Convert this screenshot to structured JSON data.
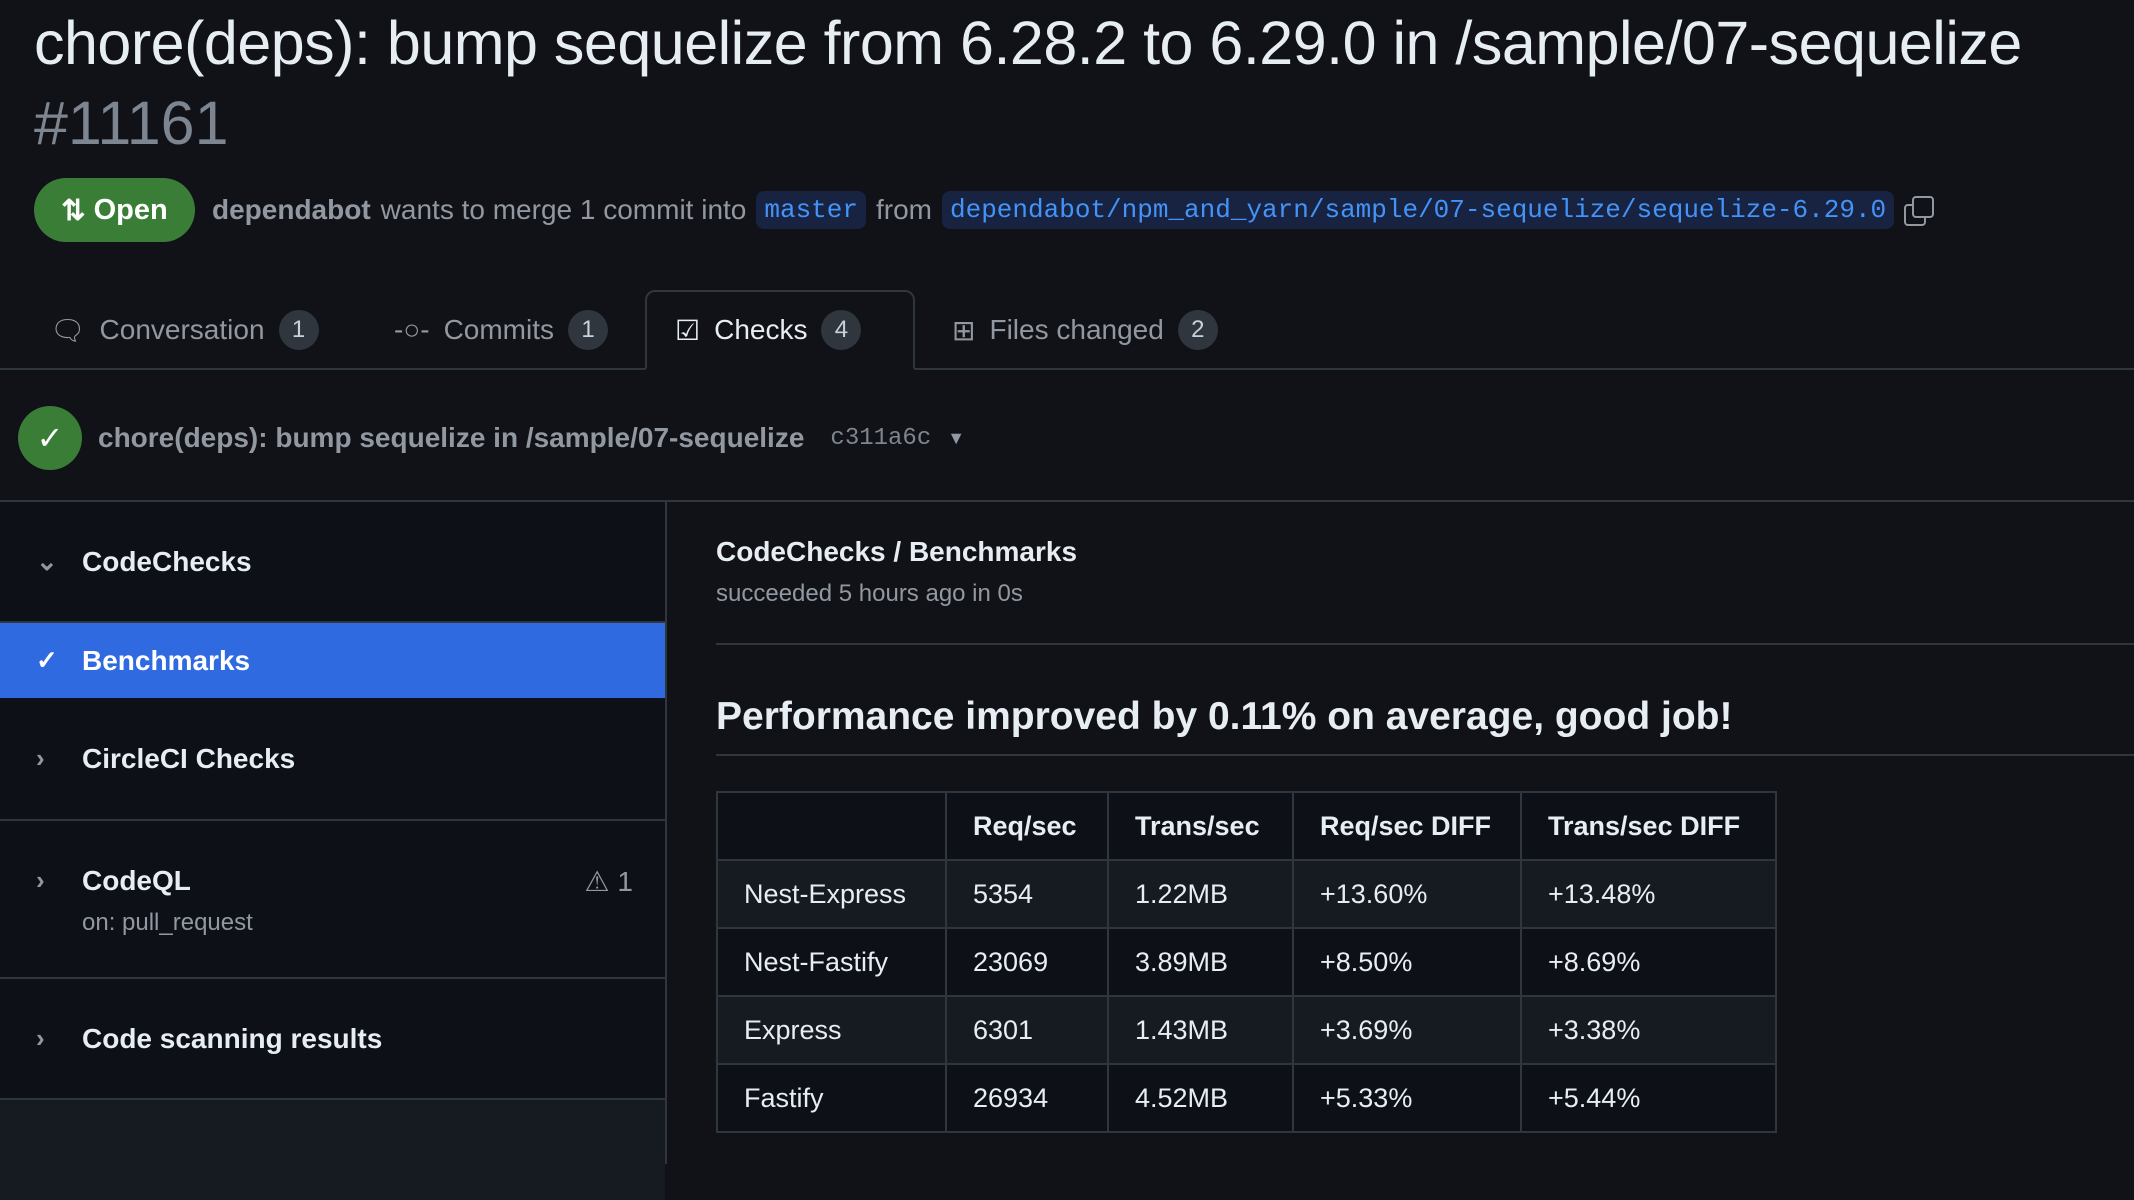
{
  "pr": {
    "title": "chore(deps): bump sequelize from 6.28.2 to 6.29.0 in /sample/07-sequelize",
    "number": "#11161",
    "state": "Open",
    "author": "dependabot",
    "merge_text": "wants to merge 1 commit into",
    "base": "master",
    "from": "from",
    "head": "dependabot/npm_and_yarn/sample/07-sequelize/sequelize-6.29.0"
  },
  "tabs": [
    {
      "label": "Conversation",
      "count": "1"
    },
    {
      "label": "Commits",
      "count": "1"
    },
    {
      "label": "Checks",
      "count": "4"
    },
    {
      "label": "Files changed",
      "count": "2"
    }
  ],
  "commit": {
    "message": "chore(deps): bump sequelize in /sample/07-sequelize",
    "sha": "c311a6c"
  },
  "sidebar": {
    "items": [
      {
        "label": "CodeChecks"
      },
      {
        "label": "Benchmarks"
      },
      {
        "label": "CircleCI Checks"
      },
      {
        "label": "CodeQL",
        "sub": "on: pull_request",
        "annotations": "1"
      },
      {
        "label": "Code scanning results"
      }
    ]
  },
  "main": {
    "title": "CodeChecks / Benchmarks",
    "status": "succeeded 5 hours ago in 0s",
    "heading": "Performance improved by 0.11% on average, good job!",
    "table": {
      "headers": [
        "",
        "Req/sec",
        "Trans/sec",
        "Req/sec DIFF",
        "Trans/sec DIFF"
      ],
      "rows": [
        [
          "Nest-Express",
          "5354",
          "1.22MB",
          "+13.60%",
          "+13.48%"
        ],
        [
          "Nest-Fastify",
          "23069",
          "3.89MB",
          "+8.50%",
          "+8.69%"
        ],
        [
          "Express",
          "6301",
          "1.43MB",
          "+3.69%",
          "+3.38%"
        ],
        [
          "Fastify",
          "26934",
          "4.52MB",
          "+5.33%",
          "+5.44%"
        ]
      ]
    }
  }
}
